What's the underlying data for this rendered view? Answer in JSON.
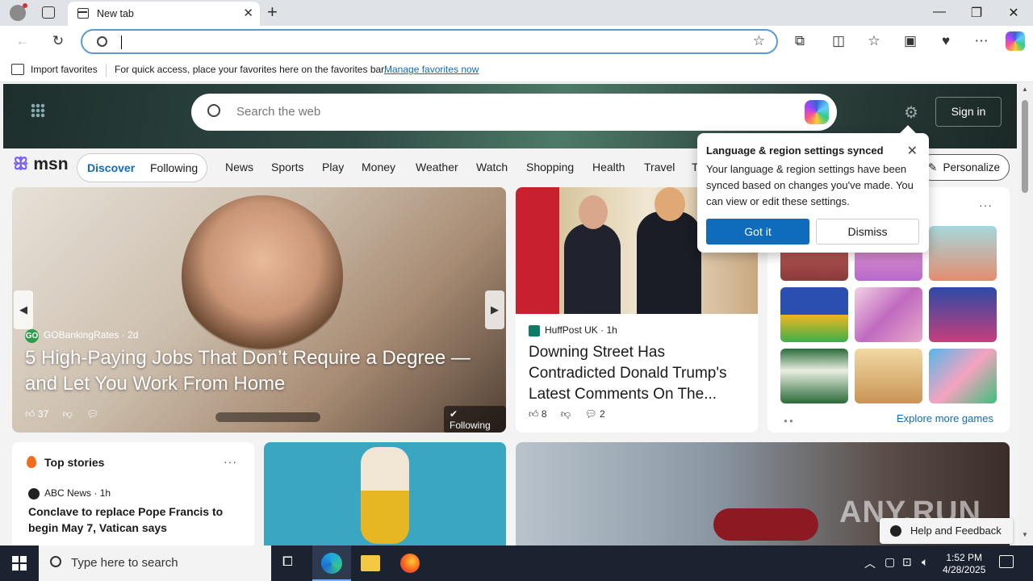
{
  "browser": {
    "tab_title": "New tab",
    "new_tab": "+",
    "address_value": "",
    "favbar": {
      "import_label": "Import favorites",
      "message": "For quick access, place your favorites here on the favorites bar.",
      "manage_link": "Manage favorites now"
    }
  },
  "msn": {
    "search_placeholder": "Search the web",
    "sign_in": "Sign in",
    "logo": "msn",
    "pill": {
      "discover": "Discover",
      "following": "Following"
    },
    "nav": [
      "News",
      "Sports",
      "Play",
      "Money",
      "Weather",
      "Watch",
      "Shopping",
      "Health",
      "Travel",
      "T"
    ],
    "personalize": "Personalize",
    "featured": {
      "source": "GOBankingRates",
      "source_badge": "GO",
      "age": "2d",
      "title": "5 High-Paying Jobs That Don’t Require a Degree — and Let You Work From Home",
      "likes": "37",
      "following": "Following"
    },
    "news": {
      "source": "HuffPost UK",
      "age": "1h",
      "title": "Downing Street Has Contradicted Donald Trump's Latest Comments On The...",
      "likes": "8",
      "comments": "2"
    },
    "games": {
      "explore": "Explore more games"
    },
    "popup": {
      "title": "Language & region settings synced",
      "body": "Your language & region settings have been synced based on changes you've made. You can view or edit these settings.",
      "got_it": "Got it",
      "dismiss": "Dismiss"
    },
    "top_stories": {
      "heading": "Top stories",
      "source": "ABC News",
      "age": "1h",
      "title": "Conclave to replace Pope Francis to begin May 7, Vatican says"
    },
    "help": "Help and Feedback",
    "watermark": "ANY.RUN"
  },
  "taskbar": {
    "search_placeholder": "Type here to search",
    "time": "1:52 PM",
    "date": "4/28/2025"
  },
  "colors": {
    "accent": "#0f6cbd",
    "taskbar": "#1b2331"
  }
}
